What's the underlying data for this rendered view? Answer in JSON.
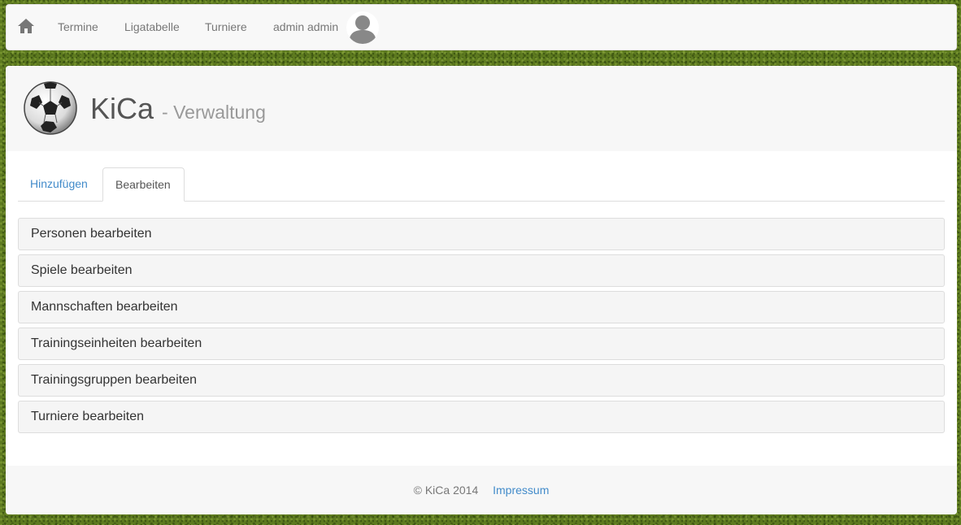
{
  "nav": {
    "home_icon": "home-icon",
    "items": [
      "Termine",
      "Ligatabelle",
      "Turniere"
    ],
    "user": "admin admin",
    "avatar_icon": "user-avatar-icon"
  },
  "header": {
    "logo_icon": "soccer-ball-icon",
    "title": "KiCa",
    "subtitle": "- Verwaltung"
  },
  "tabs": [
    "Hinzufügen",
    "Bearbeiten"
  ],
  "active_tab": "Bearbeiten",
  "list": [
    "Personen bearbeiten",
    "Spiele bearbeiten",
    "Mannschaften bearbeiten",
    "Trainingseinheiten bearbeiten",
    "Trainingsgruppen bearbeiten",
    "Turniere bearbeiten"
  ],
  "footer": {
    "copyright": "© KiCa 2014",
    "impressum": "Impressum"
  },
  "colors": {
    "link": "#428bca",
    "grass": "#5d7a1f"
  }
}
